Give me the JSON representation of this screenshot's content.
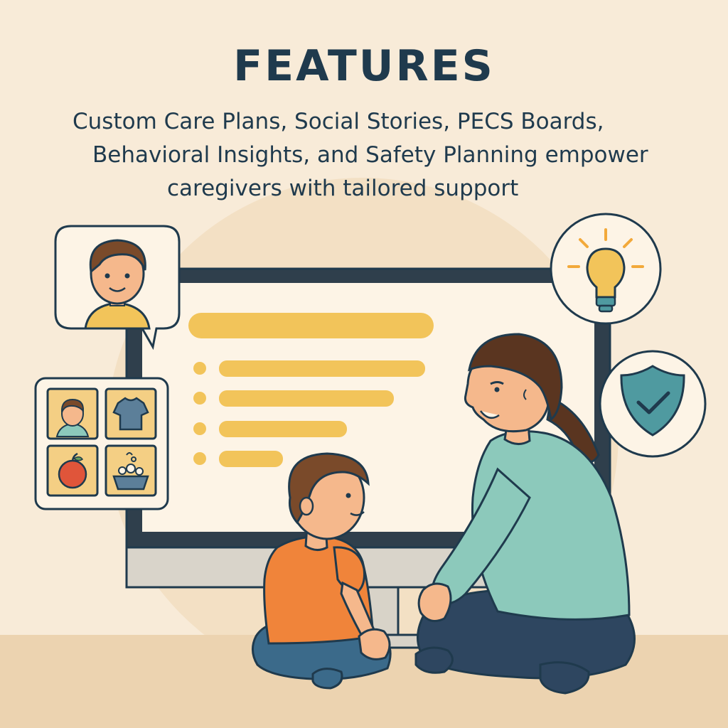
{
  "heading": "FEATURES",
  "description": {
    "line1": "Custom Care Plans, Social Stories, PECS Boards,",
    "line2": "Behavioral Insights, and Safety Planning empower",
    "line3": "caregivers with tailored support"
  },
  "icons": {
    "profile": "child-profile-icon",
    "pecs": [
      "child-card-icon",
      "shirt-card-icon",
      "apple-card-icon",
      "wash-bowl-card-icon"
    ],
    "insight": "lightbulb-icon",
    "safety": "shield-check-icon"
  },
  "colors": {
    "background": "#f8ebd8",
    "floor": "#ecd3b0",
    "ink": "#1f3a4d",
    "accent_yellow": "#f2c45a",
    "shirt_orange": "#f0843a",
    "sweater_teal": "#8cc9bb",
    "shield_teal": "#4f9aa0"
  }
}
